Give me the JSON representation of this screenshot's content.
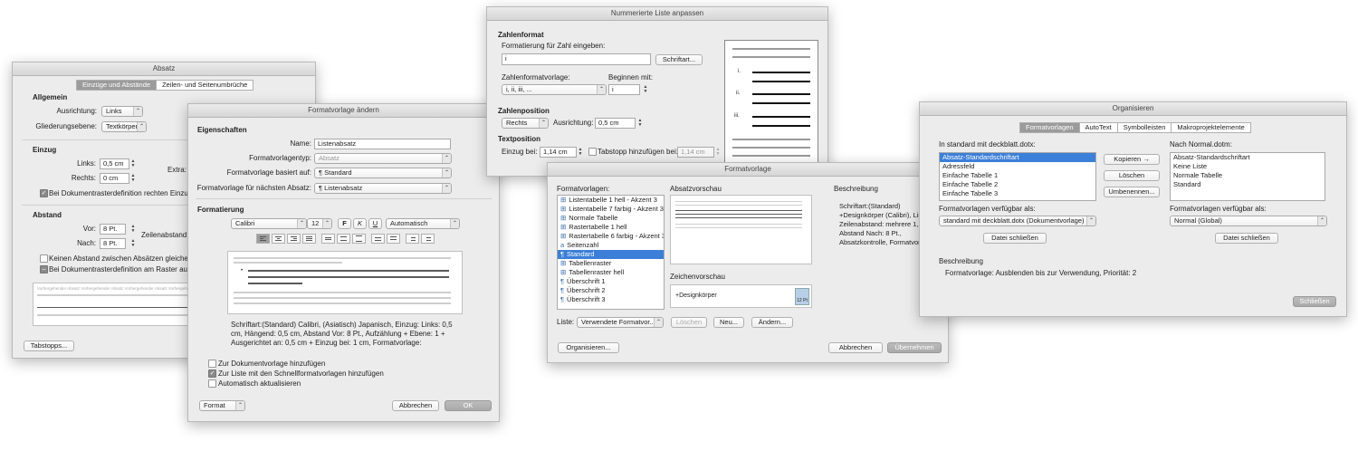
{
  "absatz": {
    "title": "Absatz",
    "tabs": [
      "Einzüge und Abstände",
      "Zeilen- und Seitenumbrüche"
    ],
    "allgemein": "Allgemein",
    "ausrichtung_label": "Ausrichtung:",
    "ausrichtung_value": "Links",
    "gliederung_label": "Gliederungsebene:",
    "gliederung_value": "Textkörper",
    "einzug": "Einzug",
    "links_label": "Links:",
    "links_value": "0,5 cm",
    "rechts_label": "Rechts:",
    "rechts_value": "0 cm",
    "extra_label": "Extra:",
    "raster_rechts": "Bei Dokumentrasterdefinition rechten Einzug a",
    "abstand": "Abstand",
    "vor_label": "Vor:",
    "vor_value": "8 Pt.",
    "nach_label": "Nach:",
    "nach_value": "8 Pt.",
    "zeilenabstand_label": "Zeilenabstand:",
    "kein_abstand": "Keinen Abstand zwischen Absätzen gleicher Fo",
    "raster_ausrichten": "Bei Dokumentrasterdefinition am Raster ausrich",
    "preview_text": "Vorhergehender Absatz Vorhergehender Absatz Vorhergehender Absatz Vorhergehender Absatz",
    "tabstopps": "Tabstopps..."
  },
  "formatvorlage_aendern": {
    "title": "Formatvorlage ändern",
    "eigenschaften": "Eigenschaften",
    "name_label": "Name:",
    "name_value": "Listenabsatz",
    "typ_label": "Formatvorlagentyp:",
    "typ_value": "Absatz",
    "basiert_label": "Formatvorlage basiert auf:",
    "basiert_value": "¶ Standard",
    "naechster_label": "Formatvorlage für nächsten Absatz:",
    "naechster_value": "¶ Listenabsatz",
    "formatierung": "Formatierung",
    "font": "Calibri",
    "size": "12",
    "bold": "F",
    "italic": "K",
    "underline": "U",
    "color": "Automatisch",
    "preview_bullet": "Beispieltext Beispieltext Beispieltext Beispieltext Beispieltext Beispieltext",
    "description": "Schriftart:(Standard) Calibri, (Asiatisch) Japanisch, Einzug: Links: 0,5 cm, Hängend: 0,5 cm, Abstand Vor: 8 Pt., Aufzählung + Ebene: 1 + Ausgerichtet an: 0,5 cm + Einzug bei: 1 cm, Formatvorlage:",
    "zur_vorlage": "Zur Dokumentvorlage hinzufügen",
    "zur_liste": "Zur Liste mit den Schnellformatvorlagen hinzufügen",
    "auto_aktual": "Automatisch aktualisieren",
    "format": "Format",
    "abbrechen": "Abbrechen",
    "ok": "OK"
  },
  "nummerierte_liste": {
    "title": "Nummerierte Liste anpassen",
    "zahlenformat": "Zahlenformat",
    "formatierung_label": "Formatierung für Zahl eingeben:",
    "formatierung_value": "i",
    "schriftart": "Schriftart...",
    "vorlage_label": "Zahlenformatvorlage:",
    "vorlage_value": "i, ii, iii, ...",
    "beginnen_label": "Beginnen mit:",
    "beginnen_value": "i",
    "zahlenposition": "Zahlenposition",
    "position_value": "Rechts",
    "ausrichtung_label": "Ausrichtung:",
    "ausrichtung_value": "0,5 cm",
    "textposition": "Textposition",
    "einzug_label": "Einzug bei:",
    "einzug_value": "1,14 cm",
    "tabstopp_label": "Tabstopp hinzufügen bei:",
    "tabstopp_value": "1,14 cm",
    "preview_numbers": [
      "i.",
      "ii.",
      "iii."
    ]
  },
  "formatvorlage": {
    "title": "Formatvorlage",
    "formatvorlagen_label": "Formatvorlagen:",
    "styles": [
      {
        "icon": "⊞",
        "name": "Listentabelle 1 hell - Akzent 3"
      },
      {
        "icon": "⊞",
        "name": "Listentabelle 7 farbig - Akzent 3"
      },
      {
        "icon": "⊞",
        "name": "Normale Tabelle"
      },
      {
        "icon": "⊞",
        "name": "Rastertabelle 1 hell"
      },
      {
        "icon": "⊞",
        "name": "Rastertabelle 6 farbig - Akzent 3"
      },
      {
        "icon": "a",
        "name": "Seitenzahl"
      },
      {
        "icon": "¶",
        "name": "Standard"
      },
      {
        "icon": "⊞",
        "name": "Tabellenraster"
      },
      {
        "icon": "⊞",
        "name": "Tabellenraster hell"
      },
      {
        "icon": "¶",
        "name": "Überschrift 1"
      },
      {
        "icon": "¶",
        "name": "Überschrift 2"
      },
      {
        "icon": "¶",
        "name": "Überschrift 3"
      }
    ],
    "absatzvorschau": "Absatzvorschau",
    "zeichenvorschau": "Zeichenvorschau",
    "zeichen_text": "+Designkörper",
    "zeichen_size": "12 Pt",
    "beschreibung": "Beschreibung",
    "beschreibung_text": "Schriftart:(Standard) +Designkörper (Calibri), Lin Zeilenabstand: mehrere 1, Abstand Nach: 8 Pt., Absatzkontrolle, Formatvorlage:",
    "liste_label": "Liste:",
    "liste_value": "Verwendete Formatvor...",
    "loeschen": "Löschen",
    "neu": "Neu...",
    "aendern": "Ändern...",
    "organisieren": "Organisieren...",
    "abbrechen": "Abbrechen",
    "uebernehmen": "Übernehmen"
  },
  "organisieren": {
    "title": "Organisieren",
    "tabs": [
      "Formatvorlagen",
      "AutoText",
      "Symbolleisten",
      "Makroprojektelemente"
    ],
    "left_label": "In standard mit deckblatt.dotx:",
    "left_items": [
      "Absatz-Standardschriftart",
      "Adressfeld",
      "Einfache Tabelle 1",
      "Einfache Tabelle 2",
      "Einfache Tabelle 3"
    ],
    "right_label": "Nach Normal.dotm:",
    "right_items": [
      "Absatz-Standardschriftart",
      "Keine Liste",
      "Normale Tabelle",
      "Standard"
    ],
    "kopieren": "Kopieren",
    "loeschen": "Löschen",
    "umbenennen": "Umbenennen...",
    "verfuegbar_label": "Formatvorlagen verfügbar als:",
    "left_verfuegbar": "standard mit deckblatt.dotx (Dokumentvorlage)",
    "right_verfuegbar": "Normal (Global)",
    "datei_schliessen": "Datei schließen",
    "beschreibung": "Beschreibung",
    "beschreibung_text": "Formatvorlage: Ausblenden bis zur Verwendung, Priorität: 2",
    "schliessen": "Schließen"
  }
}
